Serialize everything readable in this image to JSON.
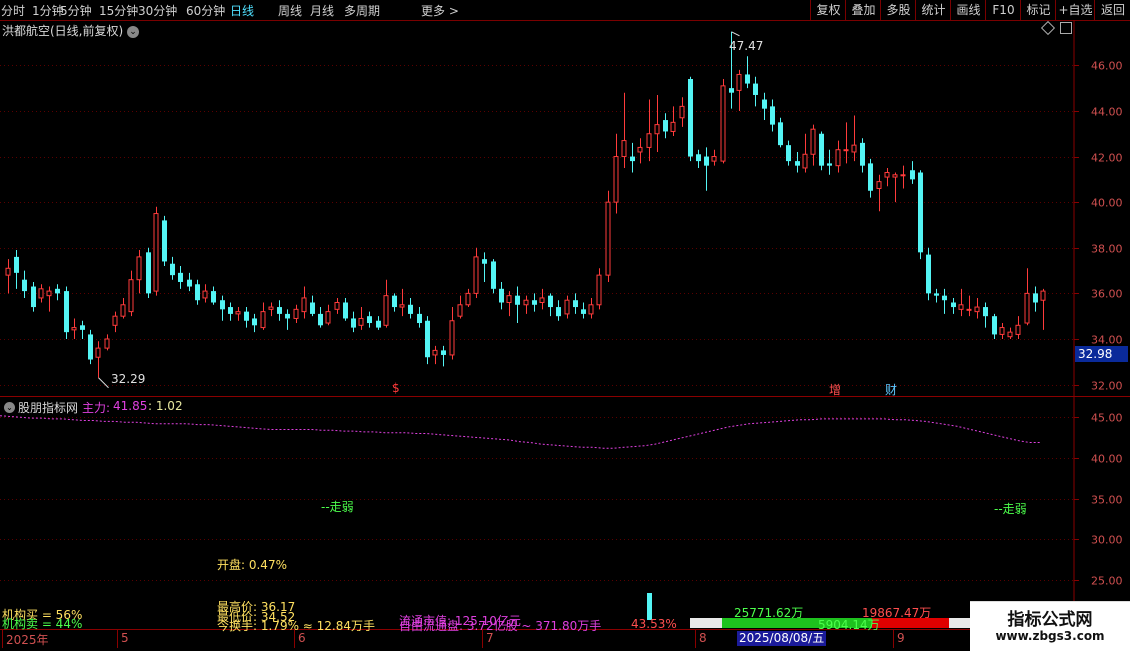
{
  "toolbar": {
    "timeframes": [
      "分时",
      "1分钟",
      "5分钟",
      "15分钟",
      "30分钟",
      "60分钟",
      "日线",
      "周线",
      "月线",
      "多周期"
    ],
    "more": "更多 >",
    "active": "日线",
    "right_buttons": [
      "复权",
      "叠加",
      "多股",
      "统计",
      "画线",
      "F10",
      "标记",
      "+自选",
      "返回"
    ]
  },
  "stock": {
    "title": "洪都航空(日线,前复权)"
  },
  "main_chart": {
    "high_label": "47.47",
    "low_label": "32.29",
    "current_price": "32.98",
    "markers": [
      {
        "text": "$",
        "color": "#ff3b3b"
      },
      {
        "text": "增",
        "color": "#ff4f4f"
      },
      {
        "text": "财",
        "color": "#60c8ff"
      }
    ]
  },
  "indicator": {
    "name": "股朋指标网",
    "line_label": "主力:",
    "line_value": "41.85",
    "extra_value": ": 1.02",
    "weak_label_left": "--走弱",
    "weak_label_right": "--走弱"
  },
  "stats": {
    "open": "开盘: 0.47%",
    "high": "最高价: 36.17",
    "low": "最低价: 34.52",
    "turnover": "今换手: 1.79% ≈ 12.84万手",
    "inst_buy": "机构买 = 56%",
    "inst_sell": "机构卖 = 44%",
    "float_cap": "自由流通盘: 3.72亿股 ~ 371.80万手",
    "float_value": "流通市值: 125.10亿元",
    "pct": "43.53%",
    "green_value": "25771.62万",
    "red_value": "19867.47万",
    "overlap_value": "5904.14万"
  },
  "date_axis": {
    "labels": [
      "2025年",
      "5",
      "6",
      "7",
      "8",
      "9"
    ],
    "cursor_date": "2025/08/08/五"
  },
  "watermark": {
    "line1": "指标公式网",
    "line2": "www.zbgs3.com"
  },
  "chart_data": {
    "type": "candlestick",
    "title": "洪都航空(日线,前复权)",
    "ylim": [
      31.5,
      47.9
    ],
    "y_ticks": [
      32.0,
      34.0,
      36.0,
      38.0,
      40.0,
      42.0,
      44.0,
      46.0
    ],
    "indicator_ylim": [
      22.5,
      47.5
    ],
    "indicator_ticks": [
      25.0,
      30.0,
      35.0,
      40.0,
      45.0
    ],
    "candles": [
      [
        36.8,
        37.1,
        36.0,
        37.5
      ],
      [
        37.6,
        36.9,
        36.2,
        37.9
      ],
      [
        36.6,
        36.1,
        35.8,
        37.0
      ],
      [
        36.3,
        35.4,
        35.2,
        36.5
      ],
      [
        35.8,
        36.2,
        35.6,
        36.4
      ],
      [
        35.9,
        36.1,
        35.2,
        36.3
      ],
      [
        36.2,
        36.0,
        35.7,
        36.4
      ],
      [
        36.1,
        34.3,
        34.0,
        36.3
      ],
      [
        34.4,
        34.5,
        34.0,
        34.9
      ],
      [
        34.6,
        34.4,
        34.0,
        34.8
      ],
      [
        34.2,
        33.1,
        32.9,
        34.4
      ],
      [
        33.2,
        33.6,
        32.3,
        33.9
      ],
      [
        33.6,
        34.0,
        33.5,
        34.2
      ],
      [
        34.6,
        35.0,
        34.3,
        35.2
      ],
      [
        35.0,
        35.5,
        34.9,
        35.8
      ],
      [
        35.2,
        36.6,
        35.0,
        37.0
      ],
      [
        36.6,
        37.6,
        36.0,
        37.9
      ],
      [
        37.8,
        36.0,
        35.8,
        38.0
      ],
      [
        36.1,
        39.5,
        35.9,
        39.8
      ],
      [
        39.2,
        37.4,
        37.2,
        39.4
      ],
      [
        37.3,
        36.8,
        36.6,
        37.6
      ],
      [
        36.9,
        36.5,
        36.2,
        37.2
      ],
      [
        36.6,
        36.3,
        36.1,
        36.9
      ],
      [
        36.4,
        35.7,
        35.5,
        36.6
      ],
      [
        35.8,
        36.1,
        35.6,
        36.4
      ],
      [
        36.1,
        35.6,
        35.5,
        36.3
      ],
      [
        35.7,
        35.3,
        34.8,
        35.9
      ],
      [
        35.4,
        35.1,
        34.8,
        35.6
      ],
      [
        35.1,
        35.2,
        34.8,
        35.4
      ],
      [
        35.2,
        34.8,
        34.5,
        35.4
      ],
      [
        34.9,
        34.6,
        34.3,
        35.1
      ],
      [
        34.5,
        35.2,
        34.4,
        35.6
      ],
      [
        35.3,
        35.4,
        35.0,
        35.6
      ],
      [
        35.4,
        35.1,
        34.8,
        35.7
      ],
      [
        35.1,
        34.9,
        34.4,
        35.3
      ],
      [
        34.9,
        35.3,
        34.7,
        35.5
      ],
      [
        35.2,
        35.8,
        34.9,
        36.3
      ],
      [
        35.6,
        35.1,
        35.0,
        35.9
      ],
      [
        35.1,
        34.6,
        34.5,
        35.4
      ],
      [
        34.7,
        35.2,
        34.6,
        35.5
      ],
      [
        35.3,
        35.6,
        35.1,
        35.8
      ],
      [
        35.6,
        34.9,
        34.8,
        35.8
      ],
      [
        34.9,
        34.5,
        34.3,
        35.2
      ],
      [
        34.6,
        34.9,
        34.4,
        35.4
      ],
      [
        35.0,
        34.7,
        34.5,
        35.2
      ],
      [
        34.8,
        34.5,
        34.4,
        35.0
      ],
      [
        34.6,
        35.9,
        34.5,
        36.6
      ],
      [
        35.9,
        35.4,
        35.2,
        36.0
      ],
      [
        35.4,
        35.5,
        35.0,
        36.2
      ],
      [
        35.5,
        35.1,
        34.9,
        35.8
      ],
      [
        35.1,
        34.7,
        34.5,
        35.4
      ],
      [
        34.8,
        33.2,
        32.9,
        35.0
      ],
      [
        33.3,
        33.5,
        32.9,
        33.7
      ],
      [
        33.5,
        33.3,
        32.8,
        33.7
      ],
      [
        33.3,
        34.8,
        33.1,
        35.4
      ],
      [
        35.0,
        35.5,
        34.9,
        35.9
      ],
      [
        35.5,
        36.0,
        35.4,
        36.2
      ],
      [
        36.0,
        37.6,
        35.8,
        38.0
      ],
      [
        37.5,
        37.3,
        36.5,
        37.8
      ],
      [
        37.4,
        36.2,
        36.0,
        37.5
      ],
      [
        36.2,
        35.6,
        35.3,
        36.5
      ],
      [
        35.6,
        35.9,
        35.0,
        36.1
      ],
      [
        35.9,
        35.5,
        34.7,
        36.3
      ],
      [
        35.5,
        35.7,
        35.1,
        35.9
      ],
      [
        35.7,
        35.5,
        35.2,
        36.0
      ],
      [
        35.6,
        35.8,
        35.3,
        36.2
      ],
      [
        35.9,
        35.4,
        35.0,
        36.0
      ],
      [
        35.4,
        35.0,
        34.8,
        35.7
      ],
      [
        35.1,
        35.7,
        34.9,
        35.9
      ],
      [
        35.7,
        35.4,
        35.1,
        36.0
      ],
      [
        35.3,
        35.1,
        34.9,
        35.6
      ],
      [
        35.1,
        35.5,
        34.9,
        35.8
      ],
      [
        35.5,
        36.8,
        35.3,
        37.1
      ],
      [
        36.8,
        40.0,
        36.5,
        40.5
      ],
      [
        40.0,
        42.0,
        39.5,
        43.0
      ],
      [
        42.0,
        42.7,
        41.5,
        44.8
      ],
      [
        42.0,
        41.8,
        41.3,
        42.6
      ],
      [
        42.2,
        42.4,
        41.7,
        42.8
      ],
      [
        42.4,
        43.0,
        41.8,
        44.5
      ],
      [
        43.0,
        43.4,
        42.2,
        44.7
      ],
      [
        43.6,
        43.1,
        42.8,
        43.9
      ],
      [
        43.1,
        43.5,
        42.9,
        44.2
      ],
      [
        43.7,
        44.2,
        43.3,
        44.6
      ],
      [
        45.4,
        42.0,
        41.8,
        45.5
      ],
      [
        42.1,
        41.8,
        41.5,
        42.3
      ],
      [
        42.0,
        41.6,
        40.5,
        42.4
      ],
      [
        41.8,
        42.0,
        41.6,
        42.3
      ],
      [
        41.8,
        45.1,
        41.7,
        45.4
      ],
      [
        45.0,
        44.8,
        44.1,
        47.47
      ],
      [
        44.9,
        45.6,
        44.0,
        45.8
      ],
      [
        45.6,
        45.2,
        45.0,
        46.4
      ],
      [
        45.2,
        44.7,
        44.2,
        45.5
      ],
      [
        44.5,
        44.1,
        43.6,
        44.8
      ],
      [
        44.2,
        43.4,
        43.1,
        44.5
      ],
      [
        43.5,
        42.5,
        42.4,
        43.7
      ],
      [
        42.5,
        41.8,
        41.6,
        42.7
      ],
      [
        41.8,
        41.6,
        41.3,
        42.2
      ],
      [
        41.5,
        42.1,
        41.3,
        43.0
      ],
      [
        42.1,
        43.2,
        41.6,
        43.4
      ],
      [
        43.0,
        41.6,
        41.4,
        43.1
      ],
      [
        41.7,
        41.6,
        41.2,
        42.3
      ],
      [
        41.6,
        42.3,
        41.3,
        42.7
      ],
      [
        42.3,
        42.3,
        41.7,
        43.5
      ],
      [
        42.2,
        42.5,
        41.8,
        43.8
      ],
      [
        42.6,
        41.6,
        41.3,
        42.8
      ],
      [
        41.7,
        40.5,
        40.2,
        41.9
      ],
      [
        40.6,
        40.9,
        39.6,
        41.2
      ],
      [
        41.1,
        41.3,
        40.7,
        41.5
      ],
      [
        41.1,
        41.2,
        40.0,
        41.3
      ],
      [
        41.2,
        41.2,
        40.6,
        41.6
      ],
      [
        41.4,
        41.0,
        40.8,
        41.8
      ],
      [
        41.3,
        37.8,
        37.5,
        41.4
      ],
      [
        37.7,
        36.0,
        35.7,
        38.0
      ],
      [
        36.0,
        35.9,
        35.6,
        36.2
      ],
      [
        35.9,
        35.7,
        35.1,
        36.2
      ],
      [
        35.6,
        35.4,
        35.1,
        35.8
      ],
      [
        35.3,
        35.5,
        35.0,
        36.2
      ],
      [
        35.3,
        35.3,
        35.0,
        35.9
      ],
      [
        35.2,
        35.4,
        34.9,
        35.8
      ],
      [
        35.4,
        35.0,
        34.5,
        35.6
      ],
      [
        35.0,
        34.2,
        34.0,
        35.1
      ],
      [
        34.2,
        34.5,
        34.0,
        34.7
      ],
      [
        34.1,
        34.3,
        34.0,
        34.5
      ],
      [
        34.2,
        34.6,
        34.0,
        35.0
      ],
      [
        34.7,
        36.0,
        34.6,
        37.1
      ],
      [
        36.0,
        35.6,
        35.2,
        36.3
      ],
      [
        35.7,
        36.1,
        34.4,
        36.2
      ]
    ],
    "indicator_series": [
      {
        "name": "主力",
        "values": [
          45.2,
          45.1,
          45.0,
          44.9,
          44.9,
          44.8,
          44.8,
          44.7,
          44.6,
          44.6,
          44.5,
          44.5,
          44.4,
          44.4,
          44.3,
          44.2,
          44.2,
          44.2,
          44.2,
          44.1,
          44.1,
          44.0,
          43.9,
          43.8,
          43.7,
          43.6,
          43.5,
          43.5,
          43.5,
          43.5,
          43.5,
          43.4,
          43.4,
          43.3,
          43.3,
          43.2,
          43.2,
          43.1,
          43.1,
          43.1,
          43.0,
          43.0,
          42.9,
          42.8,
          42.7,
          42.6,
          42.5,
          42.4,
          42.3,
          42.2,
          42.0,
          41.9,
          41.7,
          41.6,
          41.5,
          41.4,
          41.3,
          41.3,
          41.2,
          41.2,
          41.3,
          41.4,
          41.5,
          41.7,
          42.0,
          42.3,
          42.6,
          42.9,
          43.2,
          43.5,
          43.8,
          44.0,
          44.2,
          44.3,
          44.4,
          44.5,
          44.6,
          44.7,
          44.7,
          44.8,
          44.8,
          44.8,
          44.8,
          44.8,
          44.8,
          44.8,
          44.7,
          44.7,
          44.6,
          44.5,
          44.3,
          44.1,
          43.9,
          43.6,
          43.3,
          43.0,
          42.7,
          42.4,
          42.1,
          41.9,
          41.9
        ]
      }
    ]
  }
}
